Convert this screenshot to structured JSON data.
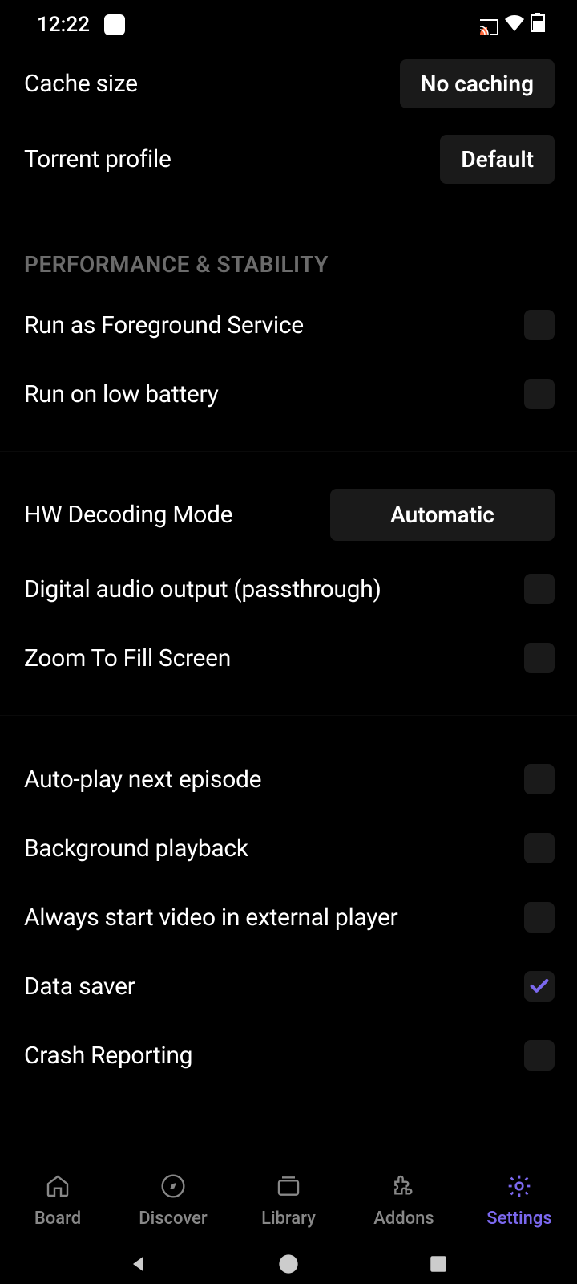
{
  "status": {
    "time": "12:22"
  },
  "rows": {
    "cache_size": {
      "label": "Cache size",
      "value": "No caching"
    },
    "torrent_profile": {
      "label": "Torrent profile",
      "value": "Default"
    },
    "hw_decoding": {
      "label": "HW Decoding Mode",
      "value": "Automatic"
    }
  },
  "sections": {
    "performance": "PERFORMANCE & STABILITY"
  },
  "toggles": {
    "foreground": "Run as Foreground Service",
    "low_battery": "Run on low battery",
    "digital_audio": "Digital audio output (passthrough)",
    "zoom_fill": "Zoom To Fill Screen",
    "autoplay": "Auto-play next episode",
    "bg_playback": "Background playback",
    "external_player": "Always start video in external player",
    "data_saver": "Data saver",
    "crash_reporting": "Crash Reporting"
  },
  "nav": {
    "board": "Board",
    "discover": "Discover",
    "library": "Library",
    "addons": "Addons",
    "settings": "Settings"
  }
}
